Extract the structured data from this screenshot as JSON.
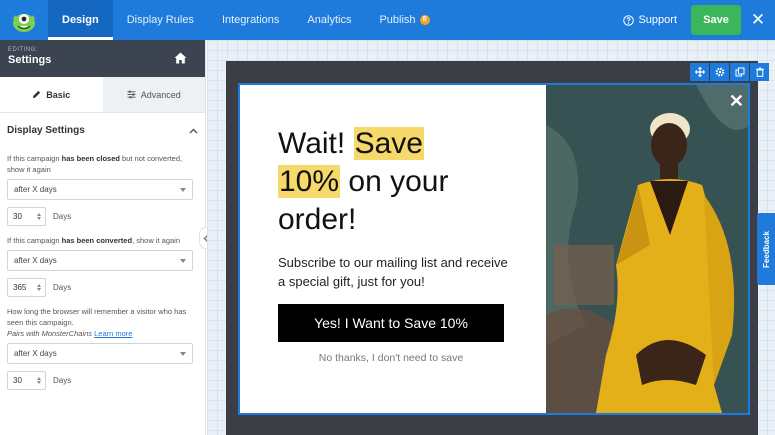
{
  "nav": {
    "tabs": [
      {
        "label": "Design"
      },
      {
        "label": "Display Rules"
      },
      {
        "label": "Integrations"
      },
      {
        "label": "Analytics"
      },
      {
        "label": "Publish"
      }
    ],
    "publish_badge": "8",
    "support_label": "Support",
    "save_label": "Save"
  },
  "sidebar": {
    "editing_label": "EDITING:",
    "editing_title": "Settings",
    "tabs": {
      "basic": "Basic",
      "advanced": "Advanced"
    },
    "section_title": "Display Settings",
    "closed_rule": {
      "pre": "If this campaign ",
      "bold": "has been closed",
      "post": " but not converted, show it again",
      "select_value": "after X days",
      "number": "30",
      "unit": "Days"
    },
    "converted_rule": {
      "pre": "If this campaign ",
      "bold": "has been converted",
      "post": ", show it again",
      "select_value": "after X days",
      "number": "365",
      "unit": "Days"
    },
    "remember_rule": {
      "text": "How long the browser will remember a visitor who has seen this campaign.",
      "pairs_text": "Pairs with MonsterChains",
      "link": "Learn more",
      "select_value": "after X days",
      "number": "30",
      "unit": "Days"
    }
  },
  "popup": {
    "headline": {
      "w1": "Wait! ",
      "h1": "Save",
      "h2": "10%",
      "w2": " on your",
      "w3": "order!"
    },
    "subtext": "Subscribe to our mailing list and receive a special gift, just for you!",
    "cta_label": "Yes! I Want to Save 10%",
    "decline_label": "No thanks, I don't need to save",
    "close_symbol": "✕"
  },
  "feedback_label": "Feedback",
  "colors": {
    "brand_blue": "#1e7bdc",
    "save_green": "#3bb65a",
    "highlight_yellow": "#f6d96b",
    "sidebar_header": "#3b4450"
  }
}
